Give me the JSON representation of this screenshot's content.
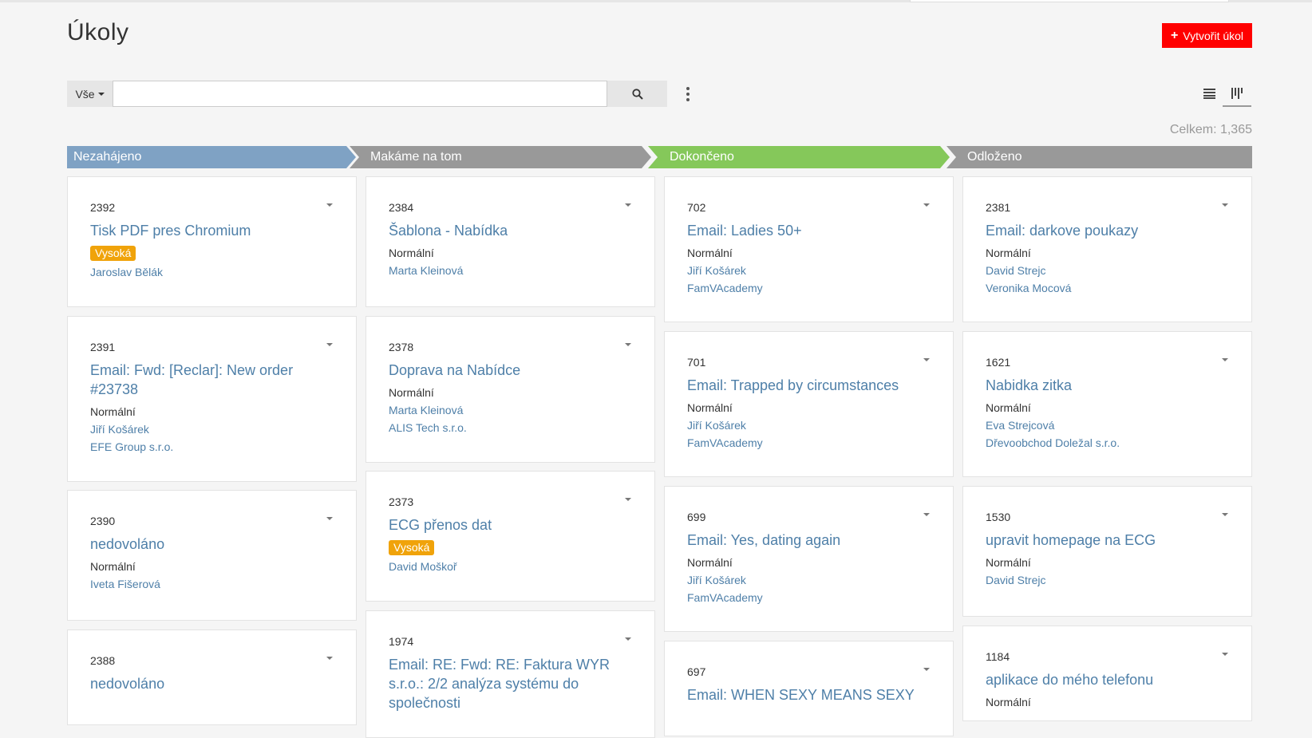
{
  "header": {
    "title": "Úkoly",
    "create_label": "Vytvořit úkol"
  },
  "toolbar": {
    "filter_label": "Vše",
    "search_value": "",
    "search_placeholder": ""
  },
  "total": "Celkem: 1,365",
  "colors": {
    "accent_red": "#ff0000",
    "stage_blue": "#7fa2c4",
    "stage_gray": "#999999",
    "stage_green": "#85c85a",
    "link_blue": "#4e7fa8",
    "priority_high": "#f0a30a"
  },
  "stages": [
    {
      "label": "Nezahájeno",
      "color": "#7fa2c4"
    },
    {
      "label": "Makáme na tom",
      "color": "#999999"
    },
    {
      "label": "Dokončeno",
      "color": "#85c85a"
    },
    {
      "label": "Odloženo",
      "color": "#999999"
    }
  ],
  "columns": [
    {
      "cards": [
        {
          "id": "2392",
          "title": "Tisk PDF pres Chromium",
          "priority": "Vysoká",
          "high": true,
          "assignee": "Jaroslav Bělák",
          "company": ""
        },
        {
          "id": "2391",
          "title": "Email: Fwd: [Reclar]: New order #23738",
          "priority": "Normální",
          "high": false,
          "assignee": "Jiří Košárek",
          "company": "EFE Group s.r.o."
        },
        {
          "id": "2390",
          "title": "nedovoláno",
          "priority": "Normální",
          "high": false,
          "assignee": "Iveta Fišerová",
          "company": ""
        },
        {
          "id": "2388",
          "title": "nedovoláno",
          "priority": "",
          "high": false,
          "assignee": "",
          "company": ""
        }
      ]
    },
    {
      "cards": [
        {
          "id": "2384",
          "title": "Šablona - Nabídka",
          "priority": "Normální",
          "high": false,
          "assignee": "Marta Kleinová",
          "company": ""
        },
        {
          "id": "2378",
          "title": "Doprava na Nabídce",
          "priority": "Normální",
          "high": false,
          "assignee": "Marta Kleinová",
          "company": "ALIS Tech s.r.o."
        },
        {
          "id": "2373",
          "title": "ECG přenos dat",
          "priority": "Vysoká",
          "high": true,
          "assignee": "David Moškoř",
          "company": ""
        },
        {
          "id": "1974",
          "title": "Email: RE: Fwd: RE: Faktura WYR s.r.o.: 2/2 analýza systému do společnosti",
          "priority": "",
          "high": false,
          "assignee": "",
          "company": ""
        }
      ]
    },
    {
      "cards": [
        {
          "id": "702",
          "title": "Email: Ladies 50+",
          "priority": "Normální",
          "high": false,
          "assignee": "Jiří Košárek",
          "company": "FamVAcademy"
        },
        {
          "id": "701",
          "title": "Email: Trapped by circumstances",
          "priority": "Normální",
          "high": false,
          "assignee": "Jiří Košárek",
          "company": "FamVAcademy"
        },
        {
          "id": "699",
          "title": "Email: Yes, dating again",
          "priority": "Normální",
          "high": false,
          "assignee": "Jiří Košárek",
          "company": "FamVAcademy"
        },
        {
          "id": "697",
          "title": "Email: WHEN SEXY MEANS SEXY",
          "priority": "",
          "high": false,
          "assignee": "",
          "company": ""
        }
      ]
    },
    {
      "cards": [
        {
          "id": "2381",
          "title": "Email: darkove poukazy",
          "priority": "Normální",
          "high": false,
          "assignee": "David Strejc",
          "company": "Veronika Mocová"
        },
        {
          "id": "1621",
          "title": "Nabidka zitka",
          "priority": "Normální",
          "high": false,
          "assignee": "Eva Strejcová",
          "company": "Dřevoobchod Doležal s.r.o."
        },
        {
          "id": "1530",
          "title": "upravit homepage na ECG",
          "priority": "Normální",
          "high": false,
          "assignee": "David Strejc",
          "company": ""
        },
        {
          "id": "1184",
          "title": "aplikace do mého telefonu",
          "priority": "Normální",
          "high": false,
          "assignee": "",
          "company": ""
        }
      ]
    }
  ]
}
